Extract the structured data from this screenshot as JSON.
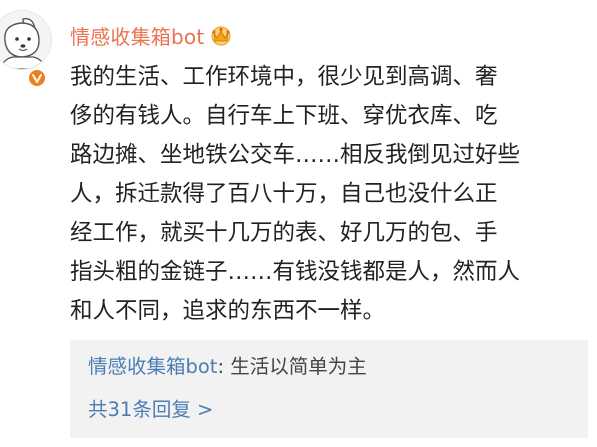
{
  "post": {
    "author": "情感收集箱bot",
    "vip_icon": "vip-crown-icon",
    "verified_icon": "verified-badge-icon",
    "content_lines": [
      "我的生活、工作环境中，很少见到高调、奢",
      "侈的有钱人。自行车上下班、穿优衣库、吃",
      "路边摊、坐地铁公交车……相反我倒见过好些",
      "人，拆迁款得了百八十万，自己也没什么正",
      "经工作，就买十几万的表、好几万的包、手",
      "指头粗的金链子……有钱没钱都是人，然而人",
      "和人不同，追求的东西不一样。"
    ]
  },
  "reply": {
    "author": "情感收集箱bot",
    "separator": ":",
    "text": "生活以简单为主",
    "count_label": "共31条回复 >"
  },
  "colors": {
    "author": "#eb7350",
    "link": "#4d7db3",
    "badge": "#f07e1b",
    "reply_bg": "#f2f2f2",
    "text": "#222222"
  }
}
